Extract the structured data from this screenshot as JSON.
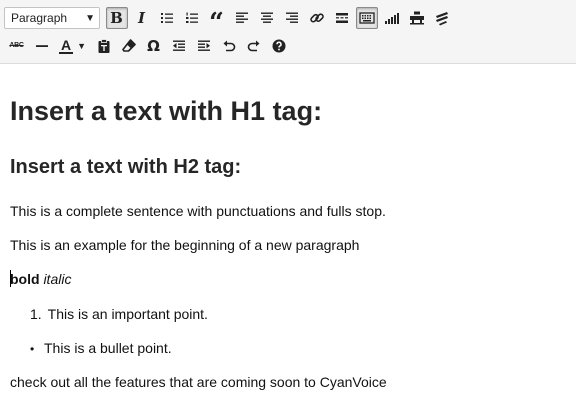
{
  "toolbar": {
    "format_select": {
      "value": "Paragraph"
    },
    "row1_icons": [
      "bold-icon",
      "italic-icon",
      "bullet-list-icon",
      "numbered-list-icon",
      "blockquote-icon",
      "align-left-icon",
      "align-center-icon",
      "align-right-icon",
      "link-icon",
      "read-more-icon",
      "toolbar-toggle-icon",
      "signal-icon",
      "tables-icon",
      "layers-icon"
    ],
    "row2_icons": [
      "strikethrough-icon",
      "horizontal-line-icon",
      "text-color-icon",
      "paste-as-text-icon",
      "clear-formatting-icon",
      "special-character-icon",
      "decrease-indent-icon",
      "increase-indent-icon",
      "undo-icon",
      "redo-icon",
      "help-icon"
    ],
    "bold_glyph": "B",
    "italic_glyph": "I",
    "blockquote_glyph": "“",
    "strike_glyph": "ABC",
    "textcolor_glyph": "A",
    "omega_glyph": "Ω",
    "active_buttons": [
      "bold",
      "toolbar-toggle"
    ]
  },
  "content": {
    "h1": "Insert a text with H1 tag:",
    "h2": "Insert a text with H2 tag:",
    "p1": "This is a complete sentence with punctuations and fulls stop.",
    "p2": "This is an example for the beginning of a new paragraph",
    "bold_text": "bold",
    "italic_text": "italic",
    "ordered_marker": "1.",
    "ordered_item": "This is an important point.",
    "bullet_marker": "•",
    "bullet_item": "This is a bullet point.",
    "p6": "check out all the features that are coming soon to CyanVoice"
  },
  "colors": {
    "toolbar_bg": "#f5f5f5",
    "heading": "#262626",
    "text": "#111111"
  }
}
